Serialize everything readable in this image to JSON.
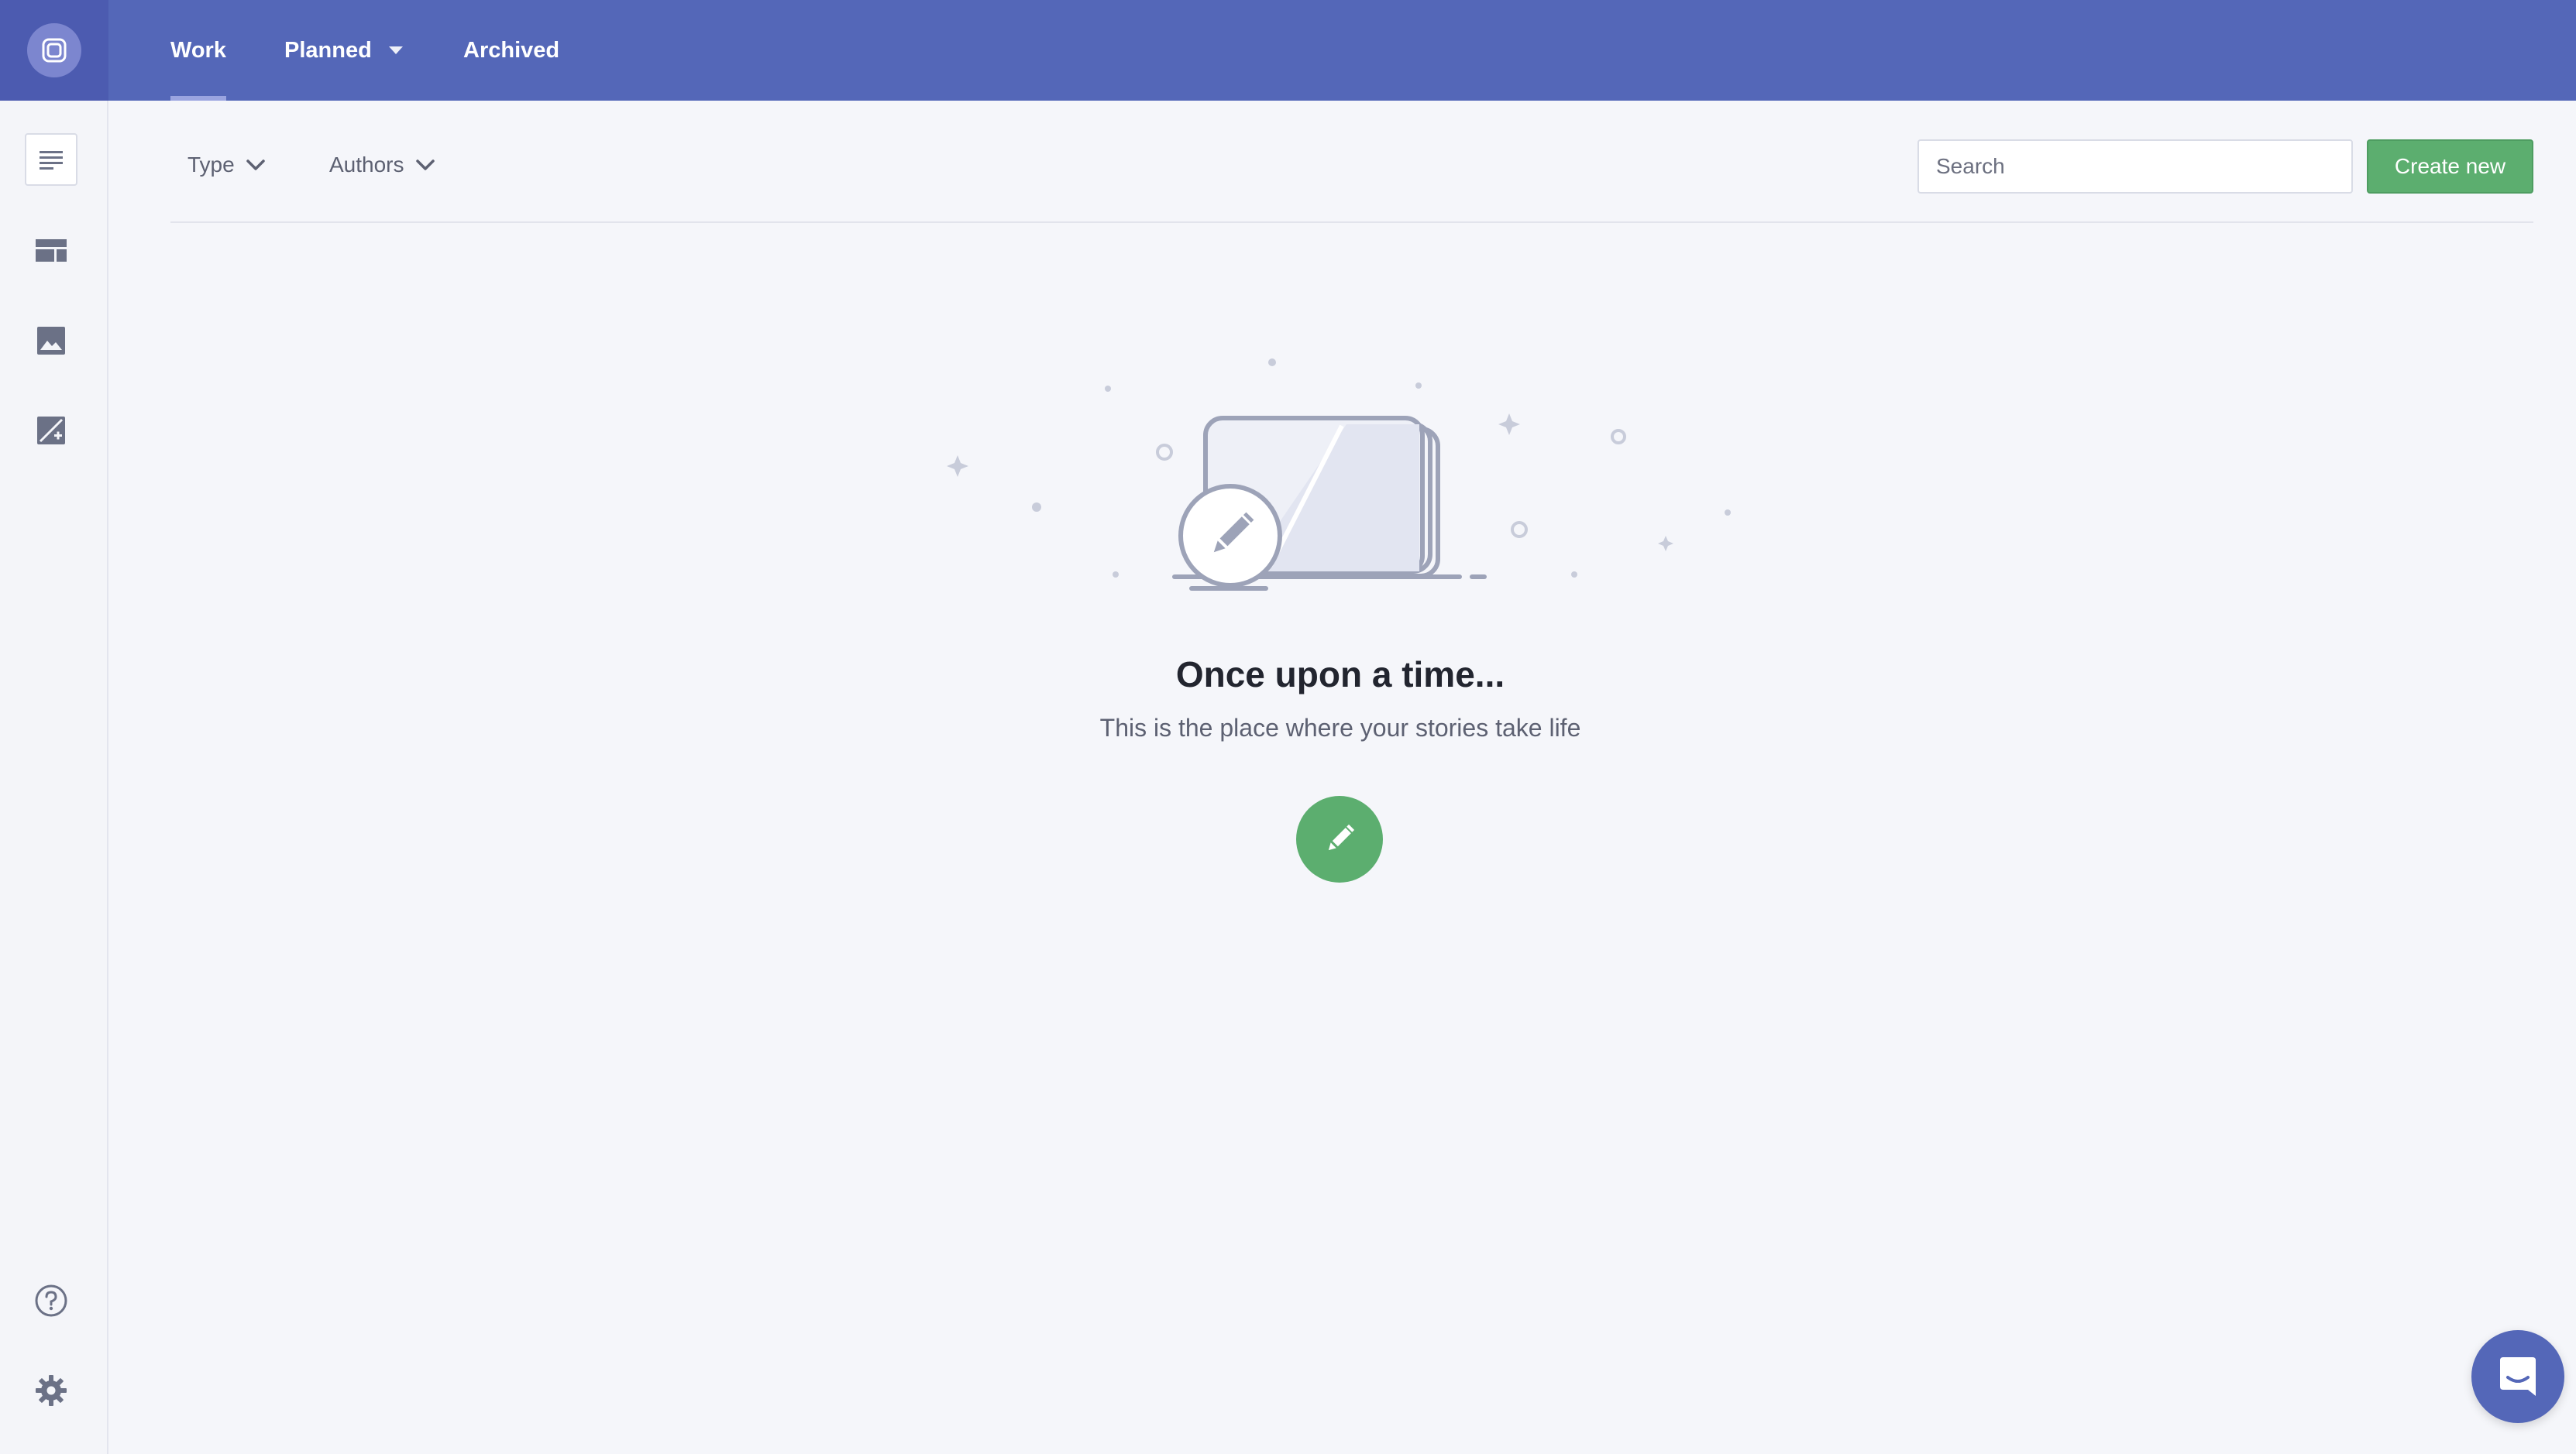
{
  "nav": {
    "tabs": [
      {
        "label": "Work",
        "active": true
      },
      {
        "label": "Planned",
        "has_dropdown": true
      },
      {
        "label": "Archived"
      }
    ]
  },
  "sidebar": {
    "items": [
      {
        "icon": "document-lines-icon",
        "active": true
      },
      {
        "icon": "layout-icon"
      },
      {
        "icon": "image-icon"
      },
      {
        "icon": "image-edit-icon"
      }
    ],
    "bottom": [
      {
        "icon": "help-icon"
      },
      {
        "icon": "gear-icon"
      }
    ]
  },
  "filters": {
    "type_label": "Type",
    "authors_label": "Authors"
  },
  "search": {
    "placeholder": "Search",
    "value": ""
  },
  "toolbar": {
    "create_label": "Create new"
  },
  "empty_state": {
    "title": "Once upon a time...",
    "subtitle": "This is the place where your stories take life"
  },
  "colors": {
    "brand": "#5467b8",
    "accent_green": "#5cae6f",
    "background": "#f5f6fa"
  }
}
